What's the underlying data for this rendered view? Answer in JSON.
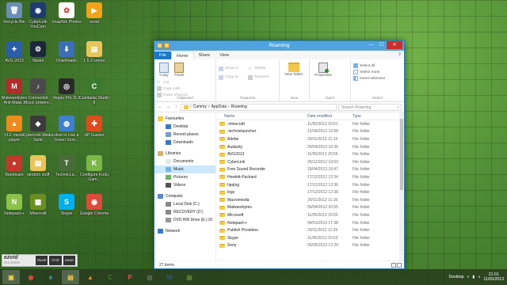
{
  "desktop": {
    "icons": [
      {
        "label": "Recycle Bin",
        "color": "#6a8fb5",
        "glyph": "🗑"
      },
      {
        "label": "CyberLink YouCam",
        "color": "#1f3b6e",
        "glyph": "◉"
      },
      {
        "label": "Snapfish Photos",
        "color": "#ffffff",
        "glyph": "✿"
      },
      {
        "label": "ezvid",
        "color": "#f0a31b",
        "glyph": "▶"
      },
      {
        "label": "AVG 2013",
        "color": "#2b5ea8",
        "glyph": "✦"
      },
      {
        "label": "Steam",
        "color": "#1b2838",
        "glyph": "⚙"
      },
      {
        "label": "Downloads",
        "color": "#3b6fb4",
        "glyph": "⬇"
      },
      {
        "label": "1.5.2 server",
        "color": "#e8c55a",
        "glyph": "▤"
      },
      {
        "label": "Malwarebytes Anti-Malw...",
        "color": "#b52a2a",
        "glyph": "M"
      },
      {
        "label": "Connected Music powere...",
        "color": "#4a4a4a",
        "glyph": "♪"
      },
      {
        "label": "Vegas Pro 11.0",
        "color": "#2a2a2a",
        "glyph": "◎"
      },
      {
        "label": "Camtasia Studio 8",
        "color": "#3a7a2e",
        "glyph": "C"
      },
      {
        "label": "VLC media player",
        "color": "#f08a1c",
        "glyph": "▲"
      },
      {
        "label": "CyberLink Media Suite",
        "color": "#3a3a3a",
        "glyph": "◆"
      },
      {
        "label": "How to Use a Green Scre...",
        "color": "#3d7fd0",
        "glyph": "◍"
      },
      {
        "label": "HP Games",
        "color": "#e04b1c",
        "glyph": "✚"
      },
      {
        "label": "Bandicam",
        "color": "#c0392b",
        "glyph": "●"
      },
      {
        "label": "random stuff",
        "color": "#e8c55a",
        "glyph": "▤"
      },
      {
        "label": "TechnicLa...",
        "color": "#4a6b3a",
        "glyph": "T"
      },
      {
        "label": "Configure Kodu Gam...",
        "color": "#7ab648",
        "glyph": "K"
      },
      {
        "label": "Notepad++",
        "color": "#8bc34a",
        "glyph": "N"
      },
      {
        "label": "Minecraft",
        "color": "#6b8e23",
        "glyph": "▦"
      },
      {
        "label": "Skype",
        "color": "#00aff0",
        "glyph": "S"
      },
      {
        "label": "Google Chrome",
        "color": "#dd4b39",
        "glyph": "◉"
      }
    ]
  },
  "window": {
    "title": "Roaming",
    "tabs": [
      "File",
      "Home",
      "Share",
      "View"
    ],
    "help_glyph": "?",
    "controls": {
      "minimize": "—",
      "maximize": "☐",
      "close": "✕"
    },
    "ribbon": {
      "clipboard": {
        "label": "Clipboard",
        "copy": "Copy",
        "paste": "Paste",
        "cut": "Cut",
        "copy_path": "Copy path",
        "paste_shortcut": "Paste shortcut"
      },
      "organize": {
        "label": "Organize",
        "move_to": "Move to",
        "copy_to": "Copy to",
        "delete": "Delete",
        "rename": "Rename"
      },
      "new": {
        "label": "New",
        "new_folder": "New folder"
      },
      "open": {
        "label": "Open",
        "properties": "Properties"
      },
      "select": {
        "label": "Select",
        "select_all": "Select all",
        "select_none": "Select none",
        "invert_selection": "Invert selection"
      }
    },
    "address": {
      "back": "←",
      "forward": "→",
      "up": "↑",
      "path": [
        "Cammy",
        "AppData",
        "Roaming"
      ],
      "separator": "›",
      "search_placeholder": "Search Roaming",
      "search_icon": "⌕"
    },
    "nav": {
      "items": [
        {
          "label": "Favourites",
          "kind": "star",
          "indent": 0,
          "selected": false
        },
        {
          "label": "Desktop",
          "kind": "desktop",
          "indent": 1,
          "selected": false
        },
        {
          "label": "Recent places",
          "kind": "recent",
          "indent": 1,
          "selected": false
        },
        {
          "label": "Downloads",
          "kind": "downloads",
          "indent": 1,
          "selected": false
        },
        {
          "label": "",
          "kind": "spacer",
          "indent": 0,
          "selected": false
        },
        {
          "label": "Libraries",
          "kind": "library",
          "indent": 0,
          "selected": false
        },
        {
          "label": "Documents",
          "kind": "documents",
          "indent": 1,
          "selected": false
        },
        {
          "label": "Music",
          "kind": "music",
          "indent": 1,
          "selected": true
        },
        {
          "label": "Pictures",
          "kind": "pictures",
          "indent": 1,
          "selected": false
        },
        {
          "label": "Videos",
          "kind": "videos",
          "indent": 1,
          "selected": false
        },
        {
          "label": "",
          "kind": "spacer",
          "indent": 0,
          "selected": false
        },
        {
          "label": "Computer",
          "kind": "computer",
          "indent": 0,
          "selected": false
        },
        {
          "label": "Local Disk (C:)",
          "kind": "disk",
          "indent": 1,
          "selected": false
        },
        {
          "label": "RECOVERY (D:)",
          "kind": "disk",
          "indent": 1,
          "selected": false
        },
        {
          "label": "DVD RW Drive (E:) ID",
          "kind": "dvd",
          "indent": 1,
          "selected": false
        },
        {
          "label": "",
          "kind": "spacer",
          "indent": 0,
          "selected": false
        },
        {
          "label": "Network",
          "kind": "network",
          "indent": 0,
          "selected": false
        }
      ]
    },
    "columns": {
      "name": "Name",
      "date": "Date modified",
      "type": "Type"
    },
    "files": [
      {
        "name": ".minecraft",
        "date": "11/05/2013 20:51",
        "type": "File folder"
      },
      {
        "name": ".techniclauncher",
        "date": "12/04/2013 12:58",
        "type": "File folder"
      },
      {
        "name": "Adobe",
        "date": "29/11/2012 11:19",
        "type": "File folder"
      },
      {
        "name": "Audacity",
        "date": "29/04/2013 16:36",
        "type": "File folder"
      },
      {
        "name": "AVG2013",
        "date": "11/05/2013 20:55",
        "type": "File folder"
      },
      {
        "name": "CyberLink",
        "date": "25/12/2012 19:03",
        "type": "File folder"
      },
      {
        "name": "Free Sound Recorder",
        "date": "29/04/2013 16:47",
        "type": "File folder"
      },
      {
        "name": "Hewlett-Packard",
        "date": "17/12/2012 12:34",
        "type": "File folder"
      },
      {
        "name": "hpqlog",
        "date": "17/12/2012 12:36",
        "type": "File folder"
      },
      {
        "name": "logs",
        "date": "17/12/2012 12:38",
        "type": "File folder"
      },
      {
        "name": "Macromedia",
        "date": "29/11/2012 11:16",
        "type": "File folder"
      },
      {
        "name": "Malwarebytes",
        "date": "09/04/2013 20:55",
        "type": "File folder"
      },
      {
        "name": "Microsoft",
        "date": "11/05/2013 19:50",
        "type": "File folder"
      },
      {
        "name": "Notepad++",
        "date": "04/01/2013 17:38",
        "type": "File folder"
      },
      {
        "name": "Publish Providers",
        "date": "29/11/2012 11:29",
        "type": "File folder"
      },
      {
        "name": "Skype",
        "date": "11/05/2013 20:53",
        "type": "File folder"
      },
      {
        "name": "Sony",
        "date": "05/05/2013 12:29",
        "type": "File folder"
      }
    ],
    "status": "27 items"
  },
  "taskbar": {
    "items": [
      {
        "name": "file-explorer-task",
        "glyph": "▣",
        "color": "#f2c84b",
        "active": true
      },
      {
        "name": "chrome-task",
        "glyph": "◉",
        "color": "#dd4b39",
        "active": false
      },
      {
        "name": "ie-task",
        "glyph": "e",
        "color": "#3aa0e0",
        "active": false
      },
      {
        "name": "explorer-task",
        "glyph": "▤",
        "color": "#f2c84b",
        "active": true
      },
      {
        "name": "vlc-task",
        "glyph": "▲",
        "color": "#f08a1c",
        "active": false
      },
      {
        "name": "camtasia-task",
        "glyph": "C",
        "color": "#3a7a2e",
        "active": false
      },
      {
        "name": "paint-task",
        "glyph": "P",
        "color": "#d9534f",
        "active": false
      },
      {
        "name": "media-task",
        "glyph": "◎",
        "color": "#7a7a7a",
        "active": false
      },
      {
        "name": "word-task",
        "glyph": "W",
        "color": "#2b579a",
        "active": false
      },
      {
        "name": "minecraft-task",
        "glyph": "▦",
        "color": "#5b7a30",
        "active": false
      }
    ],
    "desktop_label": "Desktop",
    "time": "21:01",
    "date": "11/05/2013"
  },
  "ezvid": {
    "logo": "ezvid",
    "sublabel": "RECORDER",
    "buttons": [
      "PAUSE",
      "STOP",
      "DRAW"
    ]
  }
}
